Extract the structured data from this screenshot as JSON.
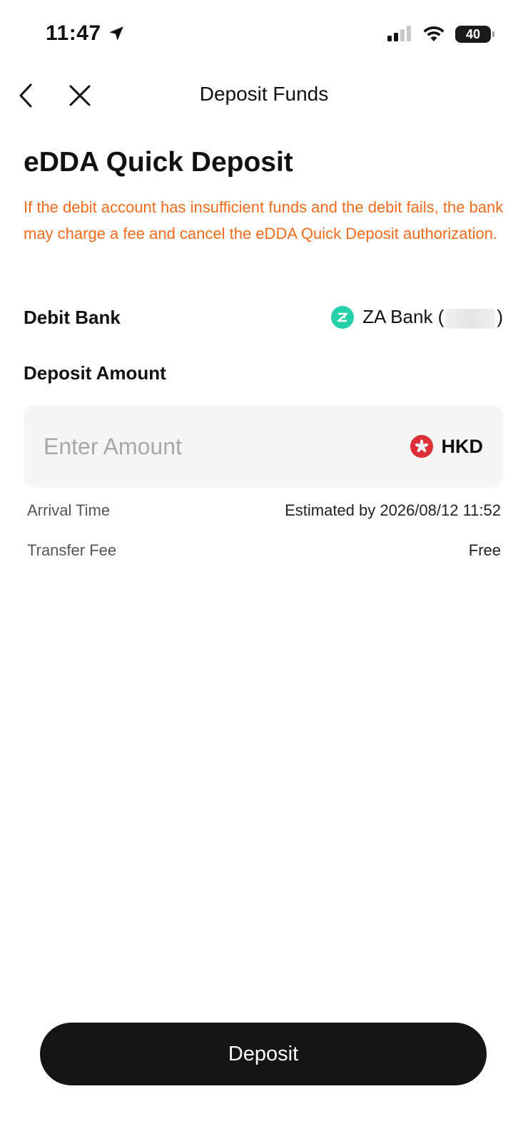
{
  "status_bar": {
    "time": "11:47",
    "battery": "40",
    "icons": [
      "location-arrow-icon",
      "cellular-signal-icon",
      "wifi-icon",
      "battery-icon"
    ]
  },
  "nav": {
    "title": "Deposit Funds",
    "icons": [
      "back-chevron-icon",
      "close-icon"
    ]
  },
  "heading": "eDDA Quick Deposit",
  "warning": "If the debit account has insufficient funds and the debit fails, the bank may charge a fee and cancel the eDDA Quick Deposit authorization.",
  "debit_bank": {
    "label": "Debit Bank",
    "name": "ZA Bank (",
    "close_paren": ")"
  },
  "deposit_amount": {
    "label": "Deposit Amount",
    "placeholder": "Enter Amount",
    "value": "",
    "currency": "HKD"
  },
  "info": {
    "arrival_label": "Arrival Time",
    "arrival_value": "Estimated by 2026/08/12 11:52",
    "fee_label": "Transfer Fee",
    "fee_value": "Free"
  },
  "button": {
    "label": "Deposit"
  },
  "colors": {
    "warning": "#f26a1b",
    "bank_logo": "#25d0a8",
    "hk_flag": "#de2f37",
    "button": "#151515"
  }
}
